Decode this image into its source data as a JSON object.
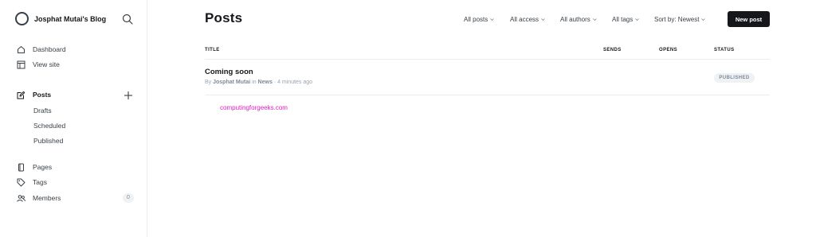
{
  "sidebar": {
    "site_title": "Josphat Mutai's Blog",
    "icons": {
      "search": "search-icon",
      "add": "plus-icon"
    },
    "top_items": [
      {
        "label": "Dashboard",
        "icon": "home-icon"
      },
      {
        "label": "View site",
        "icon": "layout-icon"
      }
    ],
    "posts": {
      "label": "Posts",
      "icon": "edit-icon"
    },
    "post_subitems": [
      {
        "label": "Drafts"
      },
      {
        "label": "Scheduled"
      },
      {
        "label": "Published"
      }
    ],
    "bottom_items": [
      {
        "label": "Pages",
        "icon": "pages-icon"
      },
      {
        "label": "Tags",
        "icon": "tag-icon"
      },
      {
        "label": "Members",
        "icon": "members-icon",
        "count": "0"
      }
    ]
  },
  "header": {
    "title": "Posts",
    "filters": [
      {
        "label": "All posts"
      },
      {
        "label": "All access"
      },
      {
        "label": "All authors"
      },
      {
        "label": "All tags"
      },
      {
        "label": "Sort by: Newest"
      }
    ],
    "new_post_label": "New post"
  },
  "table": {
    "columns": [
      "TITLE",
      "SENDS",
      "OPENS",
      "STATUS"
    ],
    "rows": [
      {
        "title": "Coming soon",
        "by_prefix": "By",
        "author": "Josphat Mutai",
        "in_word": "in",
        "tag": "News",
        "time": "· 4 minutes ago",
        "status": "PUBLISHED"
      }
    ]
  },
  "watermark": "computingforgeeks.com",
  "colors": {
    "accent": "#15171a",
    "muted": "#99a3ad",
    "watermark": "#e020c0",
    "badge_bg": "#eff1f3"
  }
}
